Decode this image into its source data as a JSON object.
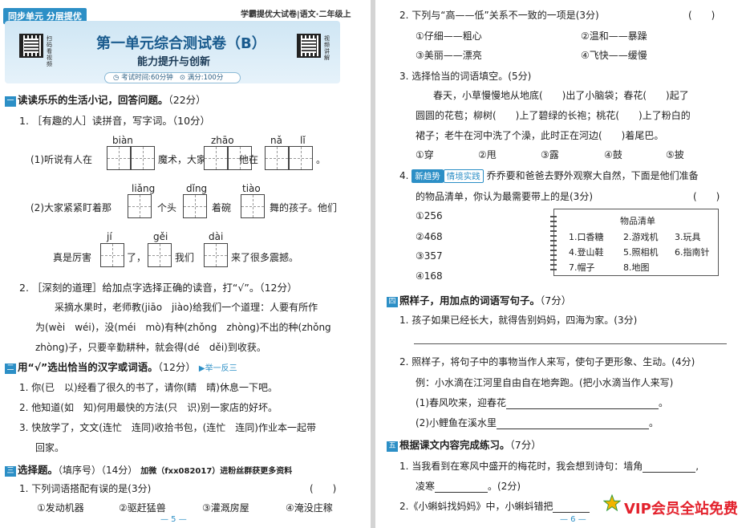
{
  "left": {
    "header": {
      "tag": "同步单元 分层提优",
      "series": "学霸提优大试卷|语文·二年级上",
      "qr_left_label": "扫码看视频",
      "qr_right_label": "视频讲解",
      "title": "第一单元综合测试卷（B）",
      "subtitle": "能力提升与创新",
      "time": "考试时间:60分钟",
      "score": "满分:100分"
    },
    "sec1": {
      "num": "一",
      "title": "读读乐乐的生活小记，回答问题。",
      "points": "（22分）",
      "q1": "1. ［有趣的人］读拼音，写字词。（10分）",
      "row1_pinyin": [
        "biàn",
        "zhāo",
        "nǎ",
        "lǐ"
      ],
      "row1_text": [
        "(1)听说有人在",
        "魔术，大家都在",
        "他在",
        "。"
      ],
      "row2_pinyin": [
        "liǎng",
        "dǐng",
        "tiào"
      ],
      "row2_text": [
        "(2)大家紧紧盯着那",
        "个头",
        "着碗",
        "舞的孩子。他们"
      ],
      "row3_pinyin": [
        "jí",
        "gěi",
        "dài"
      ],
      "row3_text": [
        "真是厉害",
        "了，",
        "我们",
        "来了很多震撼。"
      ],
      "q2": "2. ［深刻的道理］给加点字选择正确的读音，打“√”。（12分）",
      "q2_lines": [
        "采摘水果时，老师教(jiāo　jiào)给我们一个道理：人要有所作",
        "为(wèi　wéi)，没(méi　mò)有种(zhǒng　zhòng)不出的种(zhǒng",
        "zhòng)子，只要辛勤耕种，就会得(dé　děi)到收获。"
      ]
    },
    "sec2": {
      "num": "二",
      "title": "用“√”选出恰当的汉字或词语。",
      "points": "（12分）",
      "tag": "▶举一反三",
      "items": [
        "1. 你(已　以)经看了很久的书了，请你(睛　晴)休息一下吧。",
        "2. 他知道(如　知)何用最快的方法(只　识)别一家店的好坏。",
        "3. 快放学了，文文(连忙　连同)收拾书包，(连忙　连同)作业本一起带",
        "回家。"
      ]
    },
    "sec3": {
      "num": "三",
      "title": "选择题。",
      "subtitle": "（填序号）（14分）",
      "promo": "加微（fxx082017）进粉丝群获更多资料",
      "q1": "1. 下列词语搭配有误的是(3分)",
      "paren": "(　　)",
      "options": [
        "①发动机器",
        "②驱赶猛兽",
        "③灌溉房屋",
        "④淹没庄稼"
      ]
    },
    "page_num": "— 5 —"
  },
  "right": {
    "q2": "2. 下列与“高——低”关系不一致的一项是(3分)",
    "q2_paren": "(　　)",
    "q2_options": [
      "①仔细——粗心",
      "②温和——暴躁",
      "③美丽——漂亮",
      "④飞快——缓慢"
    ],
    "q3": "3. 选择恰当的词语填空。(5分)",
    "q3_lines": [
      "春天，小草慢慢地从地底(　　)出了小脑袋；春花(　　)起了",
      "圆圆的花苞；柳树(　　)上了碧绿的长袍；桃花(　　)上了粉白的",
      "裙子；老牛在河中洗了个澡，此时正在河边(　　)着尾巴。"
    ],
    "q3_options": [
      "①穿",
      "②甩",
      "③露",
      "④鼓",
      "⑤披"
    ],
    "q4_num": "4.",
    "q4_badge1": "新趋势",
    "q4_badge2": "情境实践",
    "q4_text": "乔乔要和爸爸去野外观察大自然，下面是他们准备",
    "q4_text2": "的物品清单，你认为最需要带上的是(3分)",
    "q4_paren": "(　　)",
    "q4_options": [
      "①256",
      "②468",
      "③357",
      "④168"
    ],
    "list_title": "物品清单",
    "list_items": [
      "1.口香糖",
      "2.游戏机",
      "3.玩具",
      "4.登山鞋",
      "5.照相机",
      "6.指南针",
      "7.帽子",
      "8.地图"
    ],
    "sec4": {
      "num": "四",
      "title": "照样子，用加点的词语写句子。",
      "points": "（7分）",
      "q1": "1. 孩子如果已经长大，就得告别妈妈，四海为家。(3分)",
      "q2": "2. 照样子，将句子中的事物当作人来写，使句子更形象、生动。(4分)",
      "example": "例：小水滴在江河里自由自在地奔跑。(把小水滴当作人来写)",
      "a1": "(1)春风吹来，迎春花",
      "a2": "(2)小鲤鱼在溪水里"
    },
    "sec5": {
      "num": "五",
      "title": "根据课文内容完成练习。",
      "points": "（7分）",
      "q1": "1. 当我看到在寒风中盛开的梅花时，我会想到诗句：墙角",
      "q1b": "凌寒",
      "q1c": "。(2分)",
      "q2": "2.《小蝌蚪找妈妈》中，小蝌蚪错把"
    },
    "page_num": "— 6 —"
  },
  "watermark": "VIP会员全站免费",
  "colors": {
    "accent": "#2c8fc6",
    "title": "#1a5b8e",
    "vip": "#e3222d"
  }
}
